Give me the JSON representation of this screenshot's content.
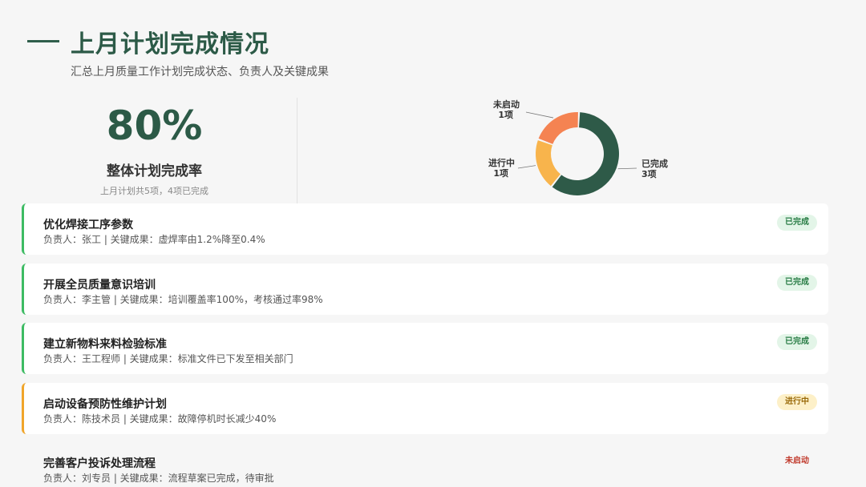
{
  "header": {
    "title": "上月计划完成情况",
    "subtitle": "汇总上月质量工作计划完成状态、负责人及关键成果"
  },
  "kpi": {
    "value": "80%",
    "label": "整体计划完成率",
    "note": "上月计划共5项，4项已完成"
  },
  "chart_data": {
    "type": "pie",
    "donut": true,
    "series": [
      {
        "name": "已完成",
        "label_line2": "3项",
        "value": 3,
        "color": "#2e5a48"
      },
      {
        "name": "进行中",
        "label_line2": "1项",
        "value": 1,
        "color": "#f8b44c"
      },
      {
        "name": "未启动",
        "label_line2": "1项",
        "value": 1,
        "color": "#f58352"
      }
    ]
  },
  "tasks": [
    {
      "title": "优化焊接工序参数",
      "meta": "负责人：张工 | 关键成果：虚焊率由1.2%降至0.4%",
      "status": "已完成",
      "kind": "done"
    },
    {
      "title": "开展全员质量意识培训",
      "meta": "负责人：李主管 | 关键成果：培训覆盖率100%，考核通过率98%",
      "status": "已完成",
      "kind": "done"
    },
    {
      "title": "建立新物料来料检验标准",
      "meta": "负责人：王工程师 | 关键成果：标准文件已下发至相关部门",
      "status": "已完成",
      "kind": "done"
    },
    {
      "title": "启动设备预防性维护计划",
      "meta": "负责人：陈技术员 | 关键成果：故障停机时长减少40%",
      "status": "进行中",
      "kind": "progress"
    },
    {
      "title": "完善客户投诉处理流程",
      "meta": "负责人：刘专员 | 关键成果：流程草案已完成，待审批",
      "status": "未启动",
      "kind": "pending"
    }
  ]
}
